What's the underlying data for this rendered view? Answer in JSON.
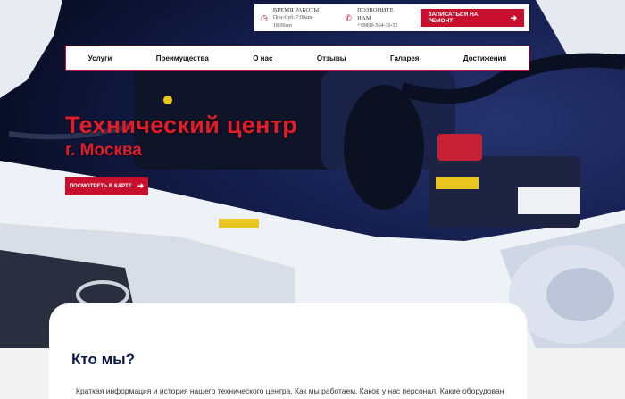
{
  "topbar": {
    "hours_label": "Время работы",
    "hours_value": "Пон-Суб: 7:00am-18:00am",
    "phone_label": "Позвоните нам",
    "phone_value": "+99890-564-16-55",
    "cta_label": "Записаться на ремонт",
    "cta_icon": "arrow-right-icon"
  },
  "nav": {
    "items": [
      "Услуги",
      "Преимущества",
      "О нас",
      "Отзывы",
      "Галарея",
      "Достижения"
    ]
  },
  "hero": {
    "title": "Технический центр",
    "subtitle": "г. Москва",
    "map_button": "Посмотреть в карте"
  },
  "about": {
    "title": "Кто мы?",
    "text": "Краткая информация и история нашего технического центра. Как мы работаем. Каков у нас персонал. Какие оборудования"
  },
  "colors": {
    "accent": "#c8102e",
    "title": "#e11d2a",
    "heading": "#0d1b4b"
  }
}
